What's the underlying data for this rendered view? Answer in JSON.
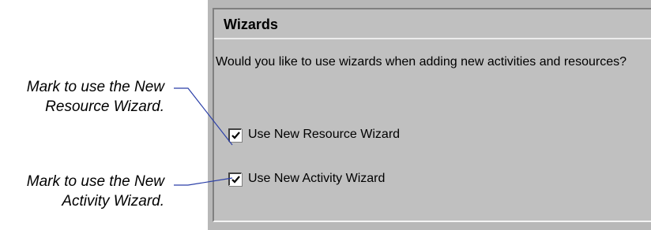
{
  "callouts": {
    "resource": {
      "line1": "Mark to use the New",
      "line2": "Resource Wizard."
    },
    "activity": {
      "line1": "Mark to use the New",
      "line2": "Activity Wizard."
    }
  },
  "panel": {
    "heading": "Wizards",
    "question": "Would you like to use wizards when adding new activities and resources?",
    "checkboxes": [
      {
        "label": "Use New Resource Wizard",
        "checked": true
      },
      {
        "label": "Use New Activity Wizard",
        "checked": true
      }
    ]
  },
  "colors": {
    "panel_background": "#c0c0c0",
    "leader_line": "#2b3fa8"
  },
  "icons": {
    "checkmark": "checkmark-icon"
  }
}
